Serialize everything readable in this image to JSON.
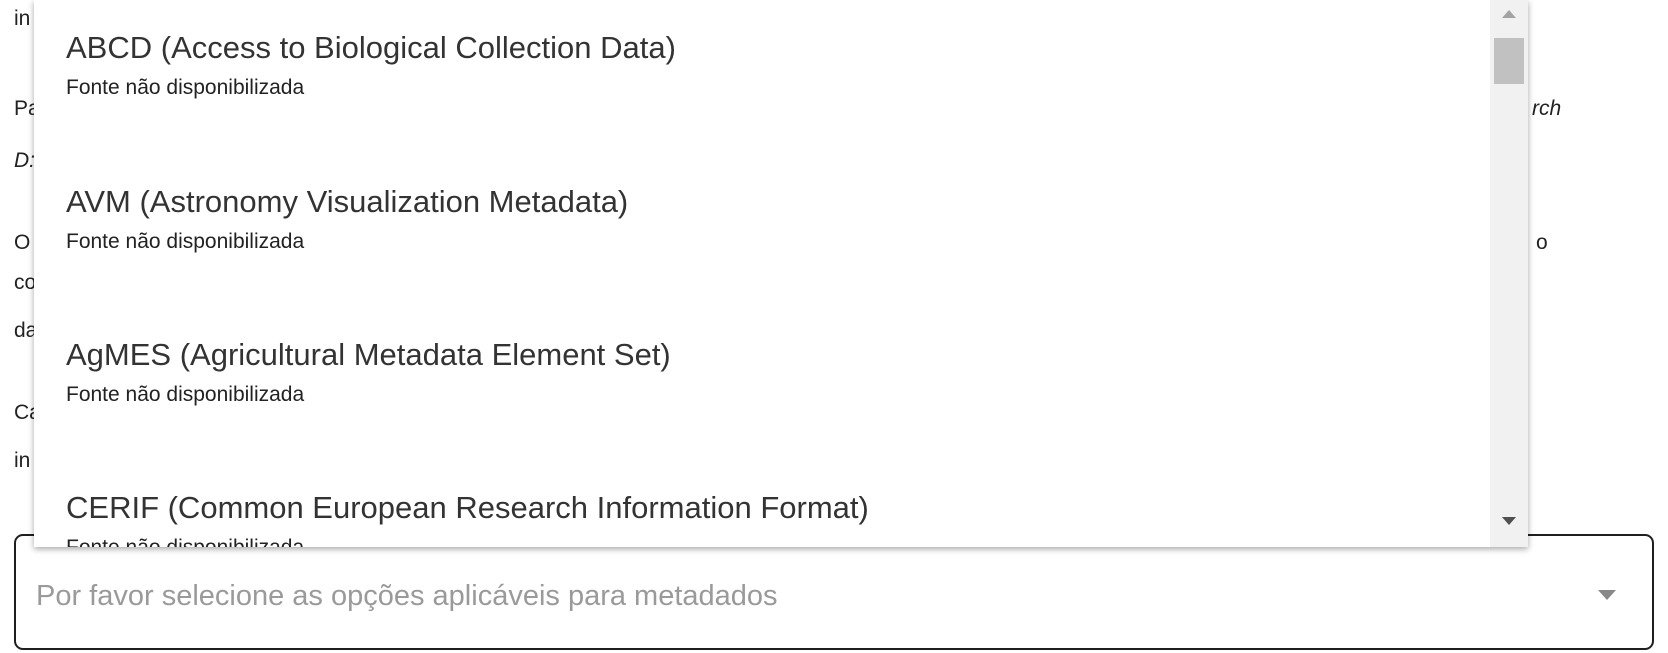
{
  "background": {
    "left_fragments": [
      "in",
      "Pa",
      "D:",
      "O",
      "co",
      "da",
      "Ca",
      "in"
    ],
    "right_fragments": [
      "rch",
      "o"
    ]
  },
  "select": {
    "placeholder": "Por favor selecione as opções aplicáveis para metadados"
  },
  "dropdown": {
    "options": [
      {
        "title": "ABCD (Access to Biological Collection Data)",
        "subtitle": "Fonte não disponibilizada"
      },
      {
        "title": "AVM (Astronomy Visualization Metadata)",
        "subtitle": "Fonte não disponibilizada"
      },
      {
        "title": "AgMES (Agricultural Metadata Element Set)",
        "subtitle": "Fonte não disponibilizada"
      },
      {
        "title": "CERIF (Common European Research Information Format)",
        "subtitle": "Fonte não disponibilizada"
      }
    ]
  },
  "icons": {
    "select_arrow": "chevron-down-icon",
    "scroll_up": "arrow-up-icon",
    "scroll_down": "arrow-down-icon"
  }
}
